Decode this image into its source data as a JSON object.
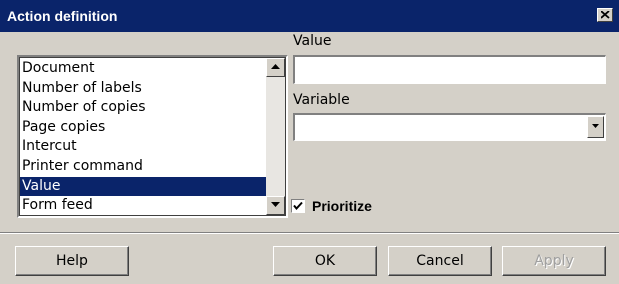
{
  "dialog": {
    "title": "Action definition"
  },
  "value_field": {
    "label": "Value",
    "value": ""
  },
  "variable_field": {
    "label": "Variable",
    "selected": ""
  },
  "action_list": {
    "items": [
      {
        "label": "Document",
        "selected": false
      },
      {
        "label": "Number of labels",
        "selected": false
      },
      {
        "label": "Number of copies",
        "selected": false
      },
      {
        "label": "Page copies",
        "selected": false
      },
      {
        "label": "Intercut",
        "selected": false
      },
      {
        "label": "Printer command",
        "selected": false
      },
      {
        "label": "Value",
        "selected": true
      },
      {
        "label": "Form feed",
        "selected": false
      }
    ]
  },
  "prioritize": {
    "label": "Prioritize",
    "checked": true
  },
  "buttons": {
    "help": "Help",
    "ok": "OK",
    "cancel": "Cancel",
    "apply": "Apply"
  },
  "colors": {
    "titlebar": "#0a246a",
    "face": "#d4d0c8",
    "selection": "#0a246a"
  }
}
